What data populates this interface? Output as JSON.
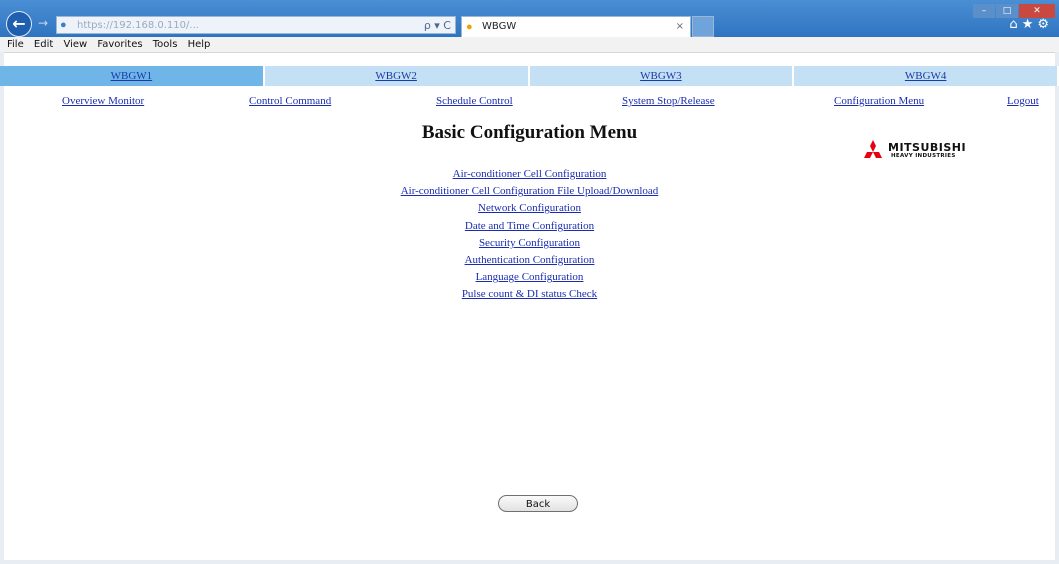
{
  "browser": {
    "url_host": "https://192.168.0.110",
    "url_path": "/...",
    "search_refresh": "ρ ▾ C",
    "tab_title": "WBGW",
    "tab_close": "×",
    "menu": [
      "File",
      "Edit",
      "View",
      "Favorites",
      "Tools",
      "Help"
    ]
  },
  "gateway_tabs": [
    {
      "label": "WBGW1",
      "active": true
    },
    {
      "label": "WBGW2",
      "active": false
    },
    {
      "label": "WBGW3",
      "active": false
    },
    {
      "label": "WBGW4",
      "active": false
    }
  ],
  "nav": {
    "overview": "Overview Monitor",
    "control": "Control Command",
    "schedule": "Schedule Control",
    "stop_release": "System Stop/Release",
    "config_menu": "Configuration Menu",
    "logout": "Logout"
  },
  "page_title": "Basic Configuration Menu",
  "logo": {
    "brand": "MITSUBISHI",
    "sub": "HEAVY INDUSTRIES",
    "mark_color": "#e60012"
  },
  "menu_items": [
    "Air-conditioner Cell Configuration",
    "Air-conditioner Cell Configuration File Upload/Download",
    "Network Configuration",
    "Date and Time Configuration",
    "Security Configuration",
    "Authentication Configuration",
    "Language Configuration",
    "Pulse count & DI status Check"
  ],
  "back_label": "Back"
}
